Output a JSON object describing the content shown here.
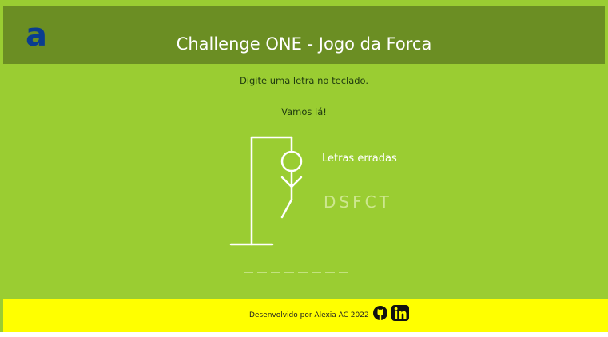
{
  "header": {
    "logo_text": "a",
    "title": "Challenge ONE - Jogo da Forca"
  },
  "game": {
    "instruction": "Digite uma letra no teclado.",
    "encouragement": "Vamos lá!",
    "wrong_letters_label": "Letras erradas",
    "wrong_letters": "DSFCT",
    "word_slots_count": 8
  },
  "footer": {
    "credit": "Desenvolvido por Alexia AC 2022",
    "icons": [
      "github-icon",
      "linkedin-icon"
    ]
  },
  "colors": {
    "background": "#9acd32",
    "header": "#6b8e23",
    "footer": "#ffff00",
    "logo": "#0a3d8f"
  }
}
